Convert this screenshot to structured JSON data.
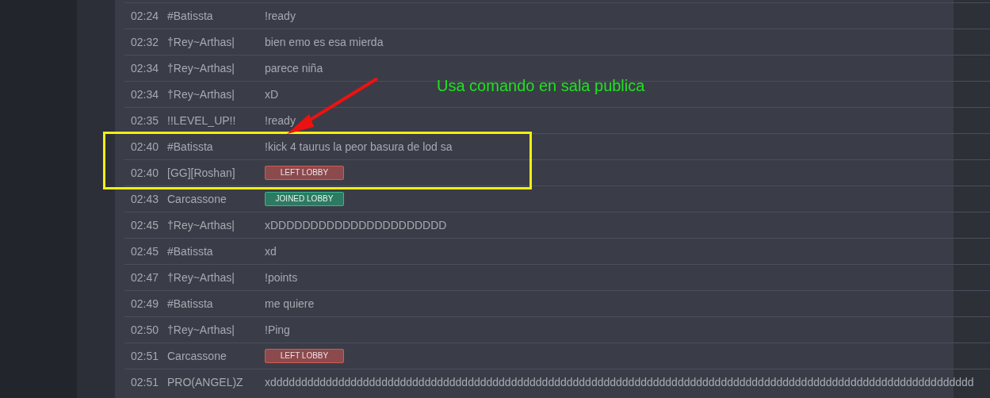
{
  "messages": [
    {
      "time": "02:24",
      "user": "#Batissta",
      "kind": "text",
      "text": "!ready"
    },
    {
      "time": "02:32",
      "user": "†Rey~Arthas|",
      "kind": "text",
      "text": "bien emo es esa mierda"
    },
    {
      "time": "02:34",
      "user": "†Rey~Arthas|",
      "kind": "text",
      "text": "parece niña"
    },
    {
      "time": "02:34",
      "user": "†Rey~Arthas|",
      "kind": "text",
      "text": "xD"
    },
    {
      "time": "02:35",
      "user": "!!LEVEL_UP!!",
      "kind": "text",
      "text": "!ready"
    },
    {
      "time": "02:40",
      "user": "#Batissta",
      "kind": "text",
      "text": "!kick 4 taurus la peor basura de lod sa"
    },
    {
      "time": "02:40",
      "user": "[GG][Roshan]",
      "kind": "left",
      "text": "LEFT LOBBY"
    },
    {
      "time": "02:43",
      "user": "Carcassone",
      "kind": "joined",
      "text": "JOINED LOBBY"
    },
    {
      "time": "02:45",
      "user": "†Rey~Arthas|",
      "kind": "text",
      "text": "xDDDDDDDDDDDDDDDDDDDDDD"
    },
    {
      "time": "02:45",
      "user": "#Batissta",
      "kind": "text",
      "text": "xd"
    },
    {
      "time": "02:47",
      "user": "†Rey~Arthas|",
      "kind": "text",
      "text": "!points"
    },
    {
      "time": "02:49",
      "user": "#Batissta",
      "kind": "text",
      "text": "me quiere"
    },
    {
      "time": "02:50",
      "user": "†Rey~Arthas|",
      "kind": "text",
      "text": "!Ping"
    },
    {
      "time": "02:51",
      "user": "Carcassone",
      "kind": "left",
      "text": "LEFT LOBBY"
    },
    {
      "time": "02:51",
      "user": "PRO(ANGEL)Z",
      "kind": "text",
      "text": "xdddddddddddddddddddddddddddddddddddddddddddddddddddddddddddddddddddddddddddddddddddddddddddddddddddddddddddddddddd"
    }
  ],
  "annotation": {
    "caption": "Usa comando en sala publica"
  }
}
